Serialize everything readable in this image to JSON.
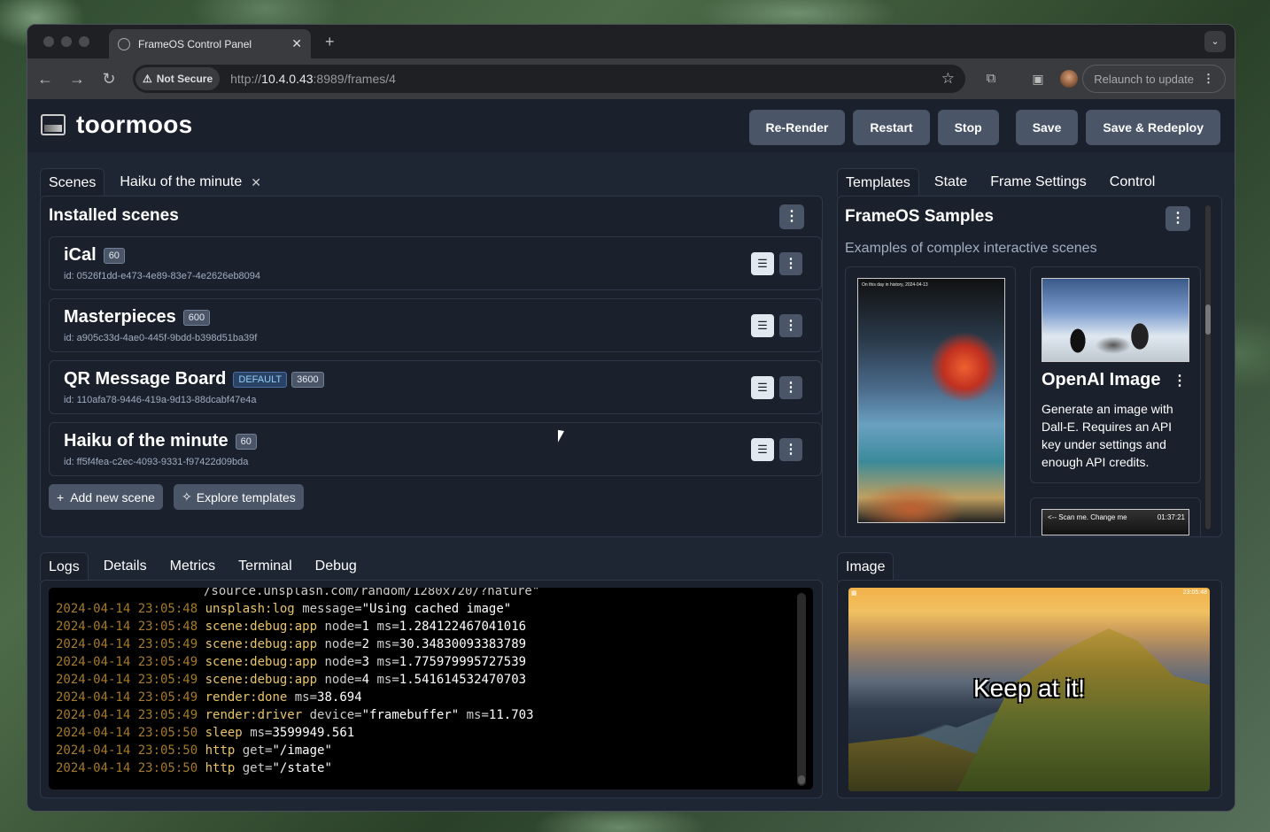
{
  "browser": {
    "tab_title": "FrameOS Control Panel",
    "tab_close": "✕",
    "new_tab": "+",
    "tab_menu": "⌄",
    "not_secure": "Not Secure",
    "url_prefix": "http://",
    "url_host": "10.4.0.43",
    "url_rest": ":8989/frames/4",
    "relaunch": "Relaunch to update"
  },
  "header": {
    "title": "toormoos",
    "buttons": [
      "Re-Render",
      "Restart",
      "Stop",
      "Save",
      "Save & Redeploy"
    ]
  },
  "scenes_panel": {
    "tabs": [
      "Scenes",
      "Haiku of the minute"
    ],
    "title": "Installed scenes",
    "scenes": [
      {
        "name": "iCal",
        "badges": [
          "60"
        ],
        "id": "id: 0526f1dd-e473-4e89-83e7-4e2626eb8094"
      },
      {
        "name": "Masterpieces",
        "badges": [
          "600"
        ],
        "id": "id: a905c33d-4ae0-445f-9bdd-b398d51ba39f"
      },
      {
        "name": "QR Message Board",
        "default_badge": "DEFAULT",
        "badges": [
          "3600"
        ],
        "id": "id: 110afa78-9446-419a-9d13-88dcabf47e4a"
      },
      {
        "name": "Haiku of the minute",
        "badges": [
          "60"
        ],
        "id": "id: ff5f4fea-c2ec-4093-9331-f97422d09bda"
      }
    ],
    "add_button": "Add new scene",
    "explore_button": "Explore templates"
  },
  "templates_panel": {
    "tabs": [
      "Templates",
      "State",
      "Frame Settings",
      "Control"
    ],
    "title": "FrameOS Samples",
    "subtitle": "Examples of complex interactive scenes",
    "cards": [
      {
        "title": "",
        "thumb_text": "On this day in history, 2024-04-13"
      },
      {
        "title": "OpenAI Image",
        "description": "Generate an image with Dall-E. Requires an API key under settings and enough API credits."
      },
      {
        "title": "",
        "thumb_left": "<-- Scan me. Change me",
        "thumb_right": "01:37:21"
      }
    ]
  },
  "logs_panel": {
    "tabs": [
      "Logs",
      "Details",
      "Metrics",
      "Terminal",
      "Debug"
    ],
    "first_line": "/source.unsplash.com/random/1280x720/?nature\"",
    "lines": [
      {
        "ts": "2024-04-14 23:05:48",
        "key": "unsplash:log",
        "rest": [
          [
            "message=",
            "\"Using cached image\""
          ]
        ]
      },
      {
        "ts": "2024-04-14 23:05:48",
        "key": "scene:debug:app",
        "rest": [
          [
            "node=",
            "1"
          ],
          [
            " ms=",
            "1.284122467041016"
          ]
        ]
      },
      {
        "ts": "2024-04-14 23:05:49",
        "key": "scene:debug:app",
        "rest": [
          [
            "node=",
            "2"
          ],
          [
            " ms=",
            "30.34830093383789"
          ]
        ]
      },
      {
        "ts": "2024-04-14 23:05:49",
        "key": "scene:debug:app",
        "rest": [
          [
            "node=",
            "3"
          ],
          [
            " ms=",
            "1.775979995727539"
          ]
        ]
      },
      {
        "ts": "2024-04-14 23:05:49",
        "key": "scene:debug:app",
        "rest": [
          [
            "node=",
            "4"
          ],
          [
            " ms=",
            "1.541614532470703"
          ]
        ]
      },
      {
        "ts": "2024-04-14 23:05:49",
        "key": "render:done",
        "rest": [
          [
            "ms=",
            "38.694"
          ]
        ]
      },
      {
        "ts": "2024-04-14 23:05:49",
        "key": "render:driver",
        "rest": [
          [
            "device=",
            "\"framebuffer\""
          ],
          [
            " ms=",
            "11.703"
          ]
        ]
      },
      {
        "ts": "2024-04-14 23:05:50",
        "key": "sleep",
        "rest": [
          [
            "ms=",
            "3599949.561"
          ]
        ]
      },
      {
        "ts": "2024-04-14 23:05:50",
        "key": "http",
        "rest": [
          [
            "get=",
            "\"/image\""
          ]
        ]
      },
      {
        "ts": "2024-04-14 23:05:50",
        "key": "http",
        "rest": [
          [
            "get=",
            "\"/state\""
          ]
        ]
      }
    ]
  },
  "image_panel": {
    "tab": "Image",
    "caption": "Keep at it!",
    "corner_time": "23:05:48"
  }
}
